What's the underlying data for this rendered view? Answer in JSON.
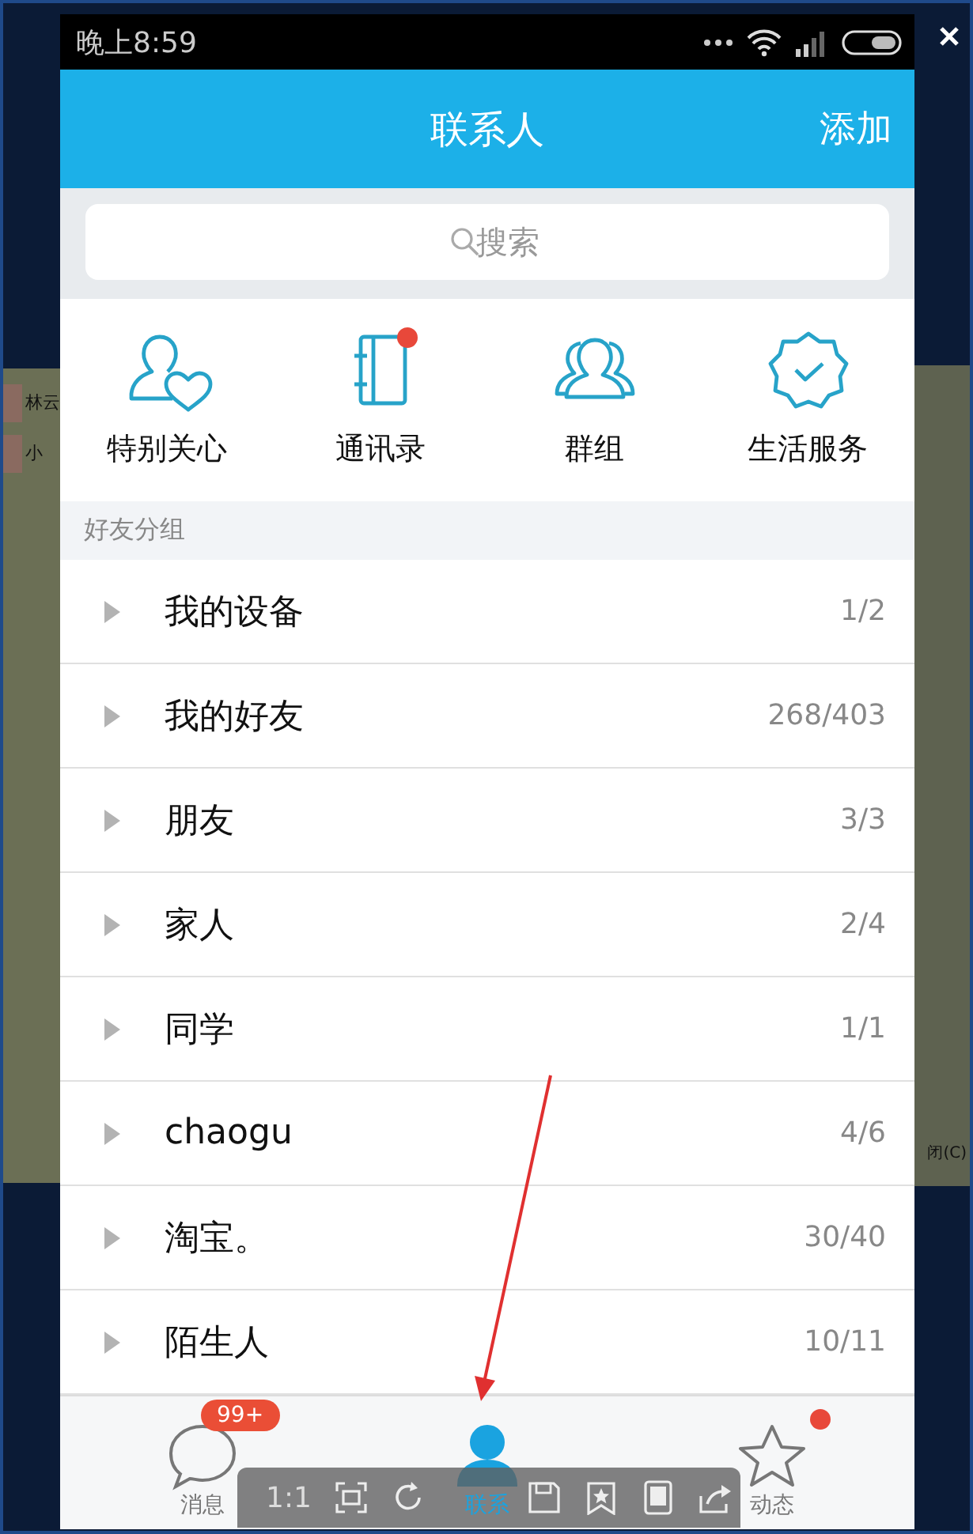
{
  "status_bar": {
    "time": "晚上8:59"
  },
  "header": {
    "title": "联系人",
    "action": "添加"
  },
  "search": {
    "placeholder": "搜索"
  },
  "shortcuts": [
    {
      "label": "特别关心",
      "kind": "heart",
      "badge": false
    },
    {
      "label": "通讯录",
      "kind": "book",
      "badge": true
    },
    {
      "label": "群组",
      "kind": "group",
      "badge": false
    },
    {
      "label": "生活服务",
      "kind": "service",
      "badge": false
    }
  ],
  "section_title": "好友分组",
  "groups": [
    {
      "name": "我的设备",
      "count": "1/2"
    },
    {
      "name": "我的好友",
      "count": "268/403"
    },
    {
      "name": "朋友",
      "count": "3/3"
    },
    {
      "name": "家人",
      "count": "2/4"
    },
    {
      "name": "同学",
      "count": "1/1"
    },
    {
      "name": "chaogu",
      "count": "4/6"
    },
    {
      "name": "淘宝。",
      "count": "30/40"
    },
    {
      "name": "陌生人",
      "count": "10/11"
    }
  ],
  "tabs": [
    {
      "label": "消息",
      "kind": "chat",
      "badge": "99+",
      "dot": false,
      "selected": false
    },
    {
      "label": "联系",
      "kind": "person",
      "dot": false,
      "selected": true
    },
    {
      "label": "动态",
      "kind": "star",
      "dot": true,
      "selected": false
    }
  ],
  "viewer_toolbar": {
    "zoom_label": "1:1"
  },
  "background": {
    "left_texts": [
      "林云",
      "小"
    ],
    "right_text": "闭(C)"
  }
}
